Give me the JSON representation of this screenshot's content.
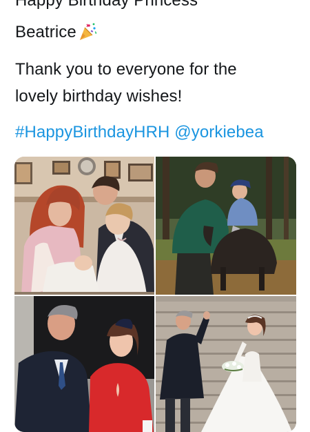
{
  "tweet": {
    "text_lines": [
      "Happy Birthday Princess",
      "Beatrice",
      "Thank you to everyone for the",
      "lovely birthday wishes!"
    ],
    "hashtag": "#HappyBirthdayHRH",
    "mention": "@yorkiebea",
    "emoji": "party-popper-icon"
  },
  "media": {
    "photos": [
      "family-portrait-photo",
      "outdoor-pony-photo",
      "red-dress-photo",
      "wedding-steps-photo"
    ]
  }
}
